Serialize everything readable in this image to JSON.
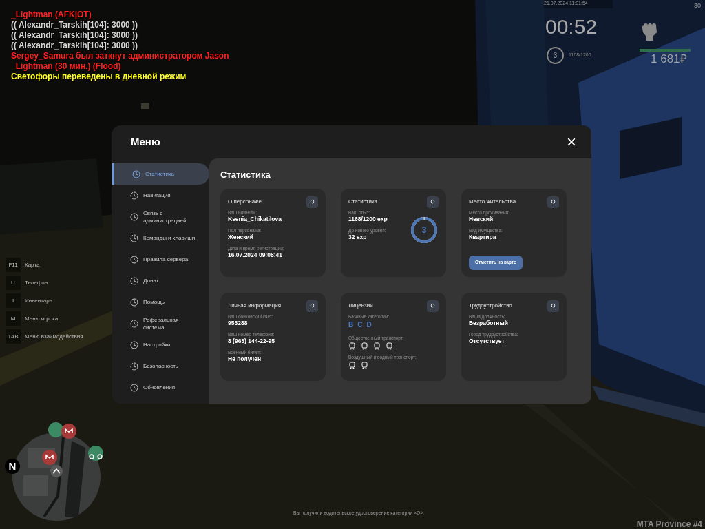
{
  "chat": [
    {
      "text": "_Lightman (AFK|OT)",
      "color": "#ff2020"
    },
    {
      "text": "(( Alexandr_Tarskih[104]: 3000 ))",
      "color": "#d8d8d8"
    },
    {
      "text": "(( Alexandr_Tarskih[104]: 3000 ))",
      "color": "#d8d8d8"
    },
    {
      "text": "(( Alexandr_Tarskih[104]: 3000 ))",
      "color": "#d8d8d8"
    },
    {
      "text": "Sergey_Samura был заткнут администратором Jason",
      "color": "#ff2020"
    },
    {
      "text": "_Lightman (30 мин.) (Flood)",
      "color": "#ff2020"
    },
    {
      "text": "Светофоры переведены в дневной режим",
      "color": "#ffff20"
    }
  ],
  "hud": {
    "datetime": "21.07.2024 11:01:54",
    "corner": "30",
    "timer": "00:52",
    "player_level": "3",
    "exp": "1168/1200",
    "health": {
      "level": 1
    },
    "money": "1 681₽"
  },
  "hotkeys": [
    {
      "key": "F11",
      "label": "Карта"
    },
    {
      "key": "U",
      "label": "Телефон"
    },
    {
      "key": "I",
      "label": "Инвентарь"
    },
    {
      "key": "M",
      "label": "Меню игрока"
    },
    {
      "key": "TAB",
      "label": "Меню взаимодействия"
    }
  ],
  "minimap": {
    "compass": "N"
  },
  "menu": {
    "title": "Меню",
    "close": "×",
    "sidebar": [
      {
        "label": "Статистика",
        "selected": true
      },
      {
        "label": "Навигация",
        "selected": false
      },
      {
        "label": "Связь с администрацией",
        "selected": false
      },
      {
        "label": "Команды и клавиши",
        "selected": false
      },
      {
        "label": "Правила сервера",
        "selected": false
      },
      {
        "label": "Донат",
        "selected": false
      },
      {
        "label": "Помощь",
        "selected": false
      },
      {
        "label": "Реферальная система",
        "selected": false
      },
      {
        "label": "Настройки",
        "selected": false
      },
      {
        "label": "Безопасность",
        "selected": false
      },
      {
        "label": "Обновления",
        "selected": false
      }
    ],
    "heading": "Статистика",
    "cards": [
      {
        "kind": "info",
        "title": "О персонаже",
        "fields": [
          {
            "label": "Ваш никнейм:",
            "value": "Ksenia_Chikatilova"
          },
          {
            "label": "Пол персонажа:",
            "value": "Женский"
          },
          {
            "label": "Дата и время регистрации:",
            "value": "16.07.2024 09:08:41"
          }
        ]
      },
      {
        "kind": "progress",
        "title": "Статистика",
        "fields": [
          {
            "label": "Ваш опыт:",
            "value": "1168/1200 exp"
          },
          {
            "label": "До нового уровня:",
            "value": "32 exp"
          }
        ],
        "ring": {
          "text": "3",
          "level": 0.973
        }
      },
      {
        "kind": "info",
        "title": "Место жительства",
        "fields": [
          {
            "label": "Место проживания:",
            "value": "Невский"
          },
          {
            "label": "Вид имущества:",
            "value": "Квартира"
          }
        ],
        "button": "Отметить на карте"
      },
      {
        "kind": "info",
        "title": "Личная информация",
        "fields": [
          {
            "label": "Ваш банковский счет:",
            "value": "953288"
          },
          {
            "label": "Ваш номер телефона:",
            "value": "8 (963) 144-22-95"
          },
          {
            "label": "Военный билет:",
            "value": "Не получен"
          }
        ]
      },
      {
        "kind": "licenses",
        "title": "Лицензии",
        "categories_label": "Базовые категории:",
        "categories": [
          "B",
          "C",
          "D"
        ],
        "groups": [
          {
            "label": "Общественный транспорт:"
          },
          {
            "label": "Воздушный и водный транспорт:"
          }
        ]
      },
      {
        "kind": "info",
        "title": "Трудоустройство",
        "fields": [
          {
            "label": "Ваша должность:",
            "value": "Безработный"
          },
          {
            "label": "Город трудоустройства:",
            "value": "Отсутствует"
          }
        ]
      }
    ]
  },
  "notification": "Вы получили водительское удостоверение категории «D».",
  "server": "MTA Province #4"
}
